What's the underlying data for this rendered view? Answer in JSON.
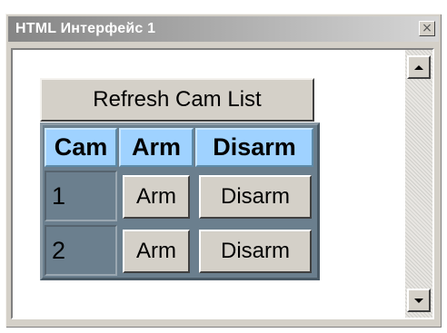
{
  "window": {
    "title": "HTML Интерфейс 1",
    "close_glyph": "×"
  },
  "toolbar": {
    "refresh_label": "Refresh Cam List"
  },
  "cam_table": {
    "headers": [
      "Cam",
      "Arm",
      "Disarm"
    ],
    "rows": [
      {
        "cam": "1",
        "arm_label": "Arm",
        "disarm_label": "Disarm"
      },
      {
        "cam": "2",
        "arm_label": "Arm",
        "disarm_label": "Disarm"
      }
    ]
  },
  "icons": {
    "close": "close-icon",
    "scroll_up": "scroll-up-arrow-icon",
    "scroll_down": "scroll-down-arrow-icon"
  },
  "colors": {
    "header_bg": "#9fd2ff",
    "table_bg": "#6b7f8e",
    "button_face": "#d4d0c8",
    "title_gradient_start": "#858585"
  }
}
